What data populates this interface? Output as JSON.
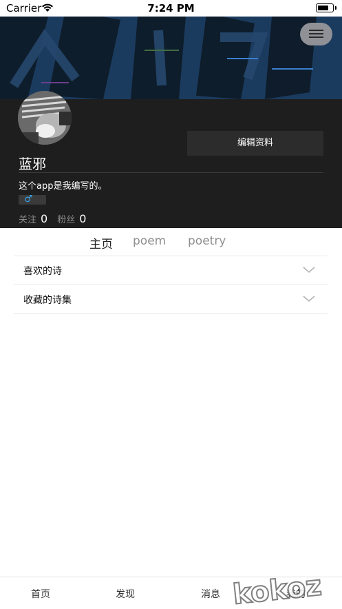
{
  "status_bar": {
    "carrier": "Carrier",
    "time": "7:24 PM",
    "battery_level": 0.85
  },
  "profile": {
    "username": "蓝邪",
    "edit_label": "编辑资料",
    "bio": "这个app是我编写的。",
    "gender_symbol": "♂",
    "following_label": "关注",
    "following_count": "0",
    "followers_label": "粉丝",
    "followers_count": "0"
  },
  "content_tabs": [
    {
      "label": "主页",
      "active": true
    },
    {
      "label": "poem",
      "active": false
    },
    {
      "label": "poetry",
      "active": false
    }
  ],
  "sections": [
    {
      "label": "喜欢的诗"
    },
    {
      "label": "收藏的诗集"
    }
  ],
  "tabbar": {
    "items": [
      {
        "label": "首页"
      },
      {
        "label": "发现"
      },
      {
        "label": "消息"
      },
      {
        "label": "我的"
      }
    ]
  },
  "watermark": "kokoz",
  "colors": {
    "banner": "#1a3a5c",
    "profile_bg": "#1e1e1e",
    "gender_accent": "#39a0e3"
  },
  "icons": [
    "wifi-icon",
    "battery-icon",
    "hamburger-menu-icon",
    "male-gender-icon",
    "chevron-down-icon"
  ]
}
